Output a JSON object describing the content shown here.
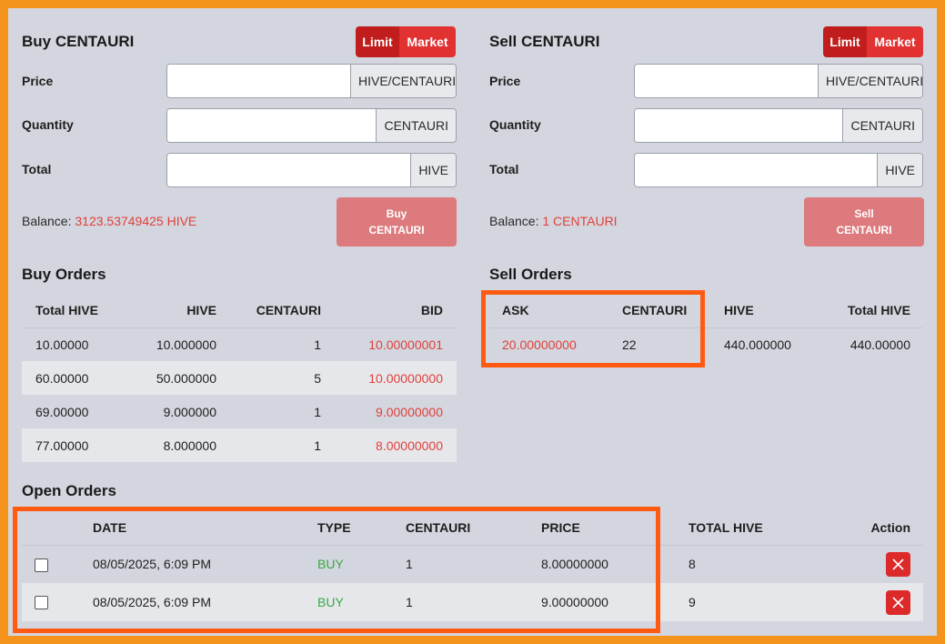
{
  "buy": {
    "title": "Buy CENTAURI",
    "limit_label": "Limit",
    "market_label": "Market",
    "price_label": "Price",
    "price_unit": "HIVE/CENTAURI",
    "quantity_label": "Quantity",
    "quantity_unit": "CENTAURI",
    "total_label": "Total",
    "total_unit": "HIVE",
    "balance_label": "Balance:",
    "balance_value": "3123.53749425 HIVE",
    "button_line1": "Buy",
    "button_line2": "CENTAURI"
  },
  "sell": {
    "title": "Sell CENTAURI",
    "limit_label": "Limit",
    "market_label": "Market",
    "price_label": "Price",
    "price_unit": "HIVE/CENTAURI",
    "quantity_label": "Quantity",
    "quantity_unit": "CENTAURI",
    "total_label": "Total",
    "total_unit": "HIVE",
    "balance_label": "Balance:",
    "balance_value": "1 CENTAURI",
    "button_line1": "Sell",
    "button_line2": "CENTAURI"
  },
  "buy_orders": {
    "title": "Buy Orders",
    "headers": [
      "Total HIVE",
      "HIVE",
      "CENTAURI",
      "BID"
    ],
    "rows": [
      [
        "10.00000",
        "10.000000",
        "1",
        "10.00000001"
      ],
      [
        "60.00000",
        "50.000000",
        "5",
        "10.00000000"
      ],
      [
        "69.00000",
        "9.000000",
        "1",
        "9.00000000"
      ],
      [
        "77.00000",
        "8.000000",
        "1",
        "8.00000000"
      ]
    ]
  },
  "sell_orders": {
    "title": "Sell Orders",
    "headers": [
      "ASK",
      "CENTAURI",
      "HIVE",
      "Total HIVE"
    ],
    "rows": [
      [
        "20.00000000",
        "22",
        "440.000000",
        "440.00000"
      ]
    ]
  },
  "open_orders": {
    "title": "Open Orders",
    "headers": [
      "DATE",
      "TYPE",
      "CENTAURI",
      "PRICE",
      "TOTAL HIVE",
      "Action"
    ],
    "rows": [
      [
        "08/05/2025, 6:09 PM",
        "BUY",
        "1",
        "8.00000000",
        "8"
      ],
      [
        "08/05/2025, 6:09 PM",
        "BUY",
        "1",
        "9.00000000",
        "9"
      ]
    ]
  },
  "colors": {
    "frame": "#f4941c",
    "panel": "#d3d6de",
    "accent_red": "#e0403c",
    "buy_green": "#3aa845",
    "highlight": "#ff5a12"
  },
  "icons": {
    "remove": "close-icon",
    "select": "checkbox"
  }
}
